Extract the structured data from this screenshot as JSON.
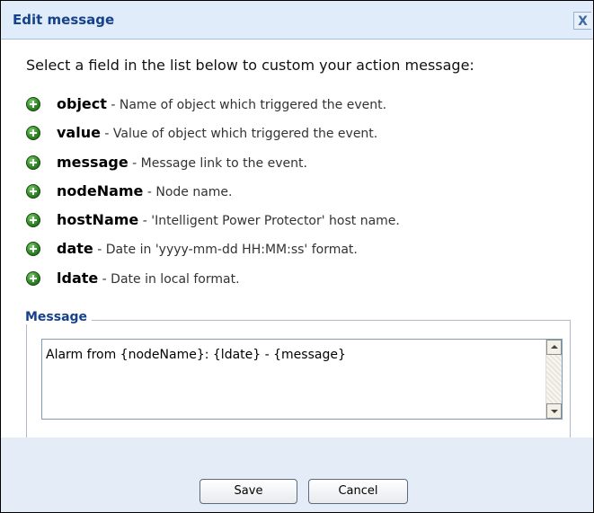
{
  "dialog": {
    "title": "Edit message",
    "close_label": "X"
  },
  "instruction": "Select a field in the list below to custom your action message:",
  "fields": [
    {
      "name": "object",
      "description": " - Name of object which triggered the event.",
      "icon": "add-icon"
    },
    {
      "name": "value",
      "description": " - Value of object which triggered the event.",
      "icon": "add-icon"
    },
    {
      "name": "message",
      "description": " - Message link to the event.",
      "icon": "add-icon"
    },
    {
      "name": "nodeName",
      "description": " - Node name.",
      "icon": "add-icon"
    },
    {
      "name": "hostName",
      "description": " - 'Intelligent Power Protector' host name.",
      "icon": "add-icon"
    },
    {
      "name": "date",
      "description": " - Date in 'yyyy-mm-dd HH:MM:ss' format.",
      "icon": "add-icon"
    },
    {
      "name": "ldate",
      "description": " - Date in local format.",
      "icon": "add-icon"
    }
  ],
  "message_section": {
    "legend": "Message",
    "value": "Alarm from {nodeName}: {ldate} - {message}"
  },
  "buttons": {
    "save": "Save",
    "cancel": "Cancel"
  },
  "colors": {
    "title_text": "#15428b",
    "titlebar_bg": "#e1ecfa",
    "footer_bg": "#e4ecf7",
    "add_icon": "#2f8a25"
  }
}
